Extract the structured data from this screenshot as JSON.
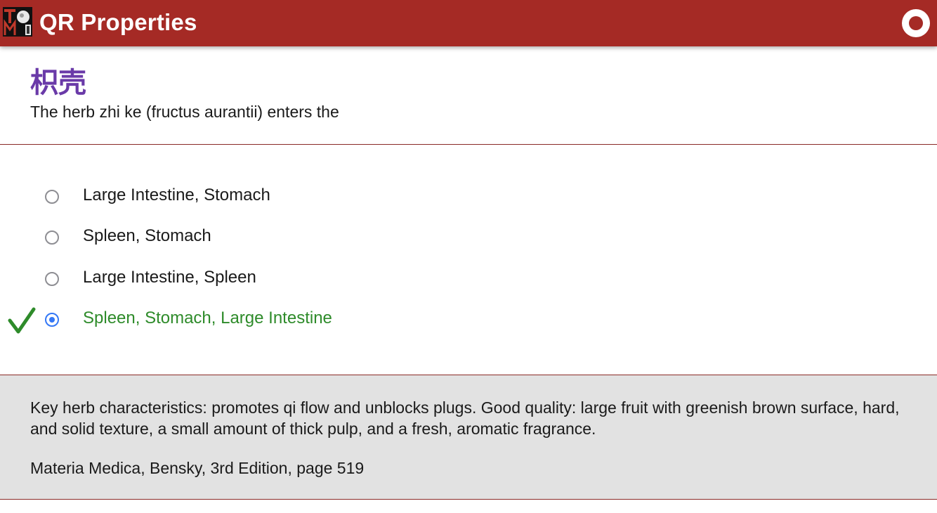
{
  "app": {
    "title": "QR Properties",
    "logo_icon": "tcm-logo-icon",
    "record_icon": "record-icon",
    "accent_color": "#a52a25"
  },
  "question": {
    "herb_chinese": "枳壳",
    "prompt": "The herb zhi ke (fructus aurantii) enters the"
  },
  "options": [
    {
      "label": "Large Intestine, Stomach",
      "selected": false,
      "correct": false
    },
    {
      "label": "Spleen, Stomach",
      "selected": false,
      "correct": false
    },
    {
      "label": "Large Intestine, Spleen",
      "selected": false,
      "correct": false
    },
    {
      "label": "Spleen, Stomach, Large Intestine",
      "selected": true,
      "correct": true
    }
  ],
  "feedback": {
    "correct_icon": "checkmark-icon",
    "correct_color": "#2e8b2a"
  },
  "explanation": {
    "text": "Key herb characteristics: promotes qi flow and unblocks plugs. Good quality: large fruit with greenish brown surface, hard, and solid texture, a small amount of thick pulp, and a fresh, aromatic fragrance.",
    "reference": "Materia Medica, Bensky, 3rd Edition, page 519"
  }
}
